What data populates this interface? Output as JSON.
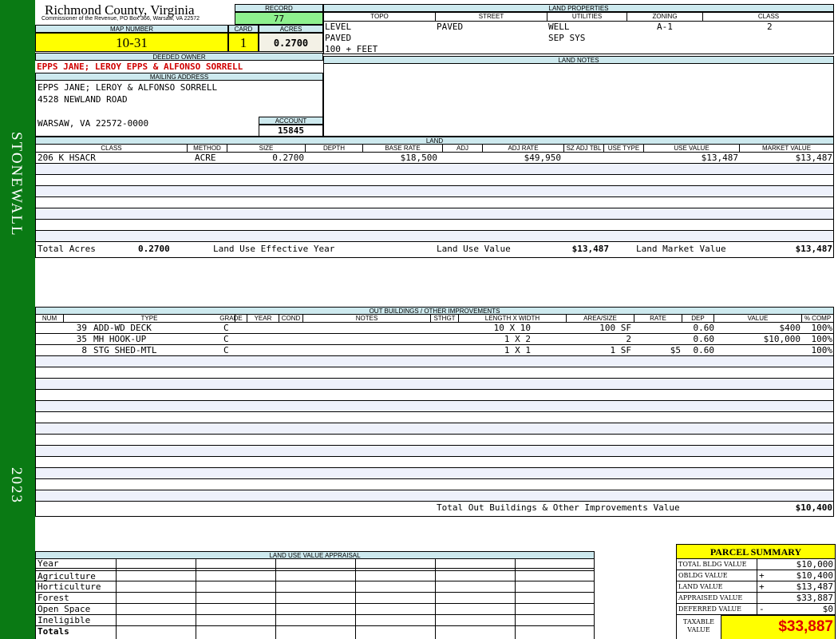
{
  "sidebar": {
    "district": "STONEWALL",
    "year": "2023"
  },
  "header": {
    "county": "Richmond County, Virginia",
    "commissioner": "Commissioner of the Revenue, PO Box 366, Warsaw, VA 22572",
    "record_label": "RECORD",
    "record": "77",
    "map_number_label": "MAP NUMBER",
    "map_number": "10-31",
    "card_label": "CARD",
    "card": "1",
    "acres_label": "ACRES",
    "acres": "0.2700",
    "deeded_owner_label": "DEEDED OWNER",
    "deeded_owner": "EPPS JANE; LEROY EPPS & ALFONSO SORRELL",
    "mailing_label": "MAILING ADDRESS",
    "mailing_1": "EPPS JANE; LEROY & ALFONSO SORRELL",
    "mailing_2": "4528 NEWLAND ROAD",
    "mailing_3": "WARSAW, VA 22572-0000",
    "account_label": "ACCOUNT",
    "account": "15845"
  },
  "land_properties": {
    "label": "LAND PROPERTIES",
    "cols": [
      "TOPO",
      "STREET",
      "UTILITIES",
      "ZONING",
      "CLASS"
    ],
    "topo": [
      "LEVEL",
      "PAVED",
      "100 + FEET"
    ],
    "street": "PAVED",
    "utilities": [
      "WELL",
      "SEP SYS"
    ],
    "zoning": "A-1",
    "class": "2"
  },
  "land_notes": {
    "label": "LAND NOTES"
  },
  "land": {
    "label": "LAND",
    "cols": [
      "CLASS",
      "METHOD",
      "SIZE",
      "DEPTH",
      "BASE RATE",
      "ADJ",
      "ADJ RATE",
      "SZ ADJ TBL",
      "USE TYPE",
      "USE VALUE",
      "MARKET VALUE"
    ],
    "row": {
      "class": "206 K HSACR",
      "method": "ACRE",
      "size": "0.2700",
      "base_rate": "$18,500",
      "adj_rate": "$49,950",
      "use_value": "$13,487",
      "market_value": "$13,487"
    },
    "total_acres_label": "Total Acres",
    "total_acres": "0.2700",
    "effective_year_label": "Land Use Effective Year",
    "use_value_label": "Land Use Value",
    "use_value": "$13,487",
    "market_value_label": "Land Market Value",
    "market_value": "$13,487"
  },
  "outbuildings": {
    "label": "OUT BUILDINGS / OTHER IMPROVEMENTS",
    "cols": [
      "NUM",
      "TYPE",
      "GRADE",
      "YEAR",
      "COND",
      "NOTES",
      "STHGT",
      "LENGTH X WIDTH",
      "AREA/SIZE",
      "RATE",
      "DEP",
      "VALUE",
      "% COMP"
    ],
    "rows": [
      {
        "num": "39",
        "type": "ADD-WD DECK",
        "grade": "C",
        "lw": "10 X 10",
        "area": "100 SF",
        "rate": "",
        "dep": "0.60",
        "value": "$400",
        "comp": "100%"
      },
      {
        "num": "35",
        "type": "MH HOOK-UP",
        "grade": "C",
        "lw": "1 X 2",
        "area": "2",
        "rate": "",
        "dep": "0.60",
        "value": "$10,000",
        "comp": "100%"
      },
      {
        "num": "8",
        "type": "STG SHED-MTL",
        "grade": "C",
        "lw": "1 X 1",
        "area": "1 SF",
        "rate": "$5",
        "dep": "0.60",
        "value": "",
        "comp": "100%"
      }
    ],
    "total_label": "Total Out Buildings & Other Improvements Value",
    "total": "$10,400"
  },
  "land_use_appraisal": {
    "label": "LAND USE VALUE APPRAISAL",
    "rows": [
      "Year",
      "Agriculture",
      "Horticulture",
      "Forest",
      "Open Space",
      "Ineligible",
      "Totals"
    ]
  },
  "summary": {
    "title": "PARCEL SUMMARY",
    "rows": [
      {
        "label": "TOTAL BLDG VALUE",
        "op": "",
        "value": "$10,000"
      },
      {
        "label": "OBLDG VALUE",
        "op": "+",
        "value": "$10,400"
      },
      {
        "label": "LAND VALUE",
        "op": "+",
        "value": "$13,487"
      },
      {
        "label": "APPRAISED VALUE",
        "op": "",
        "value": "$33,887"
      },
      {
        "label": "DEFERRED VALUE",
        "op": "-",
        "value": "$0"
      }
    ],
    "taxable_label_1": "TAXABLE",
    "taxable_label_2": "VALUE",
    "taxable": "$33,887"
  }
}
